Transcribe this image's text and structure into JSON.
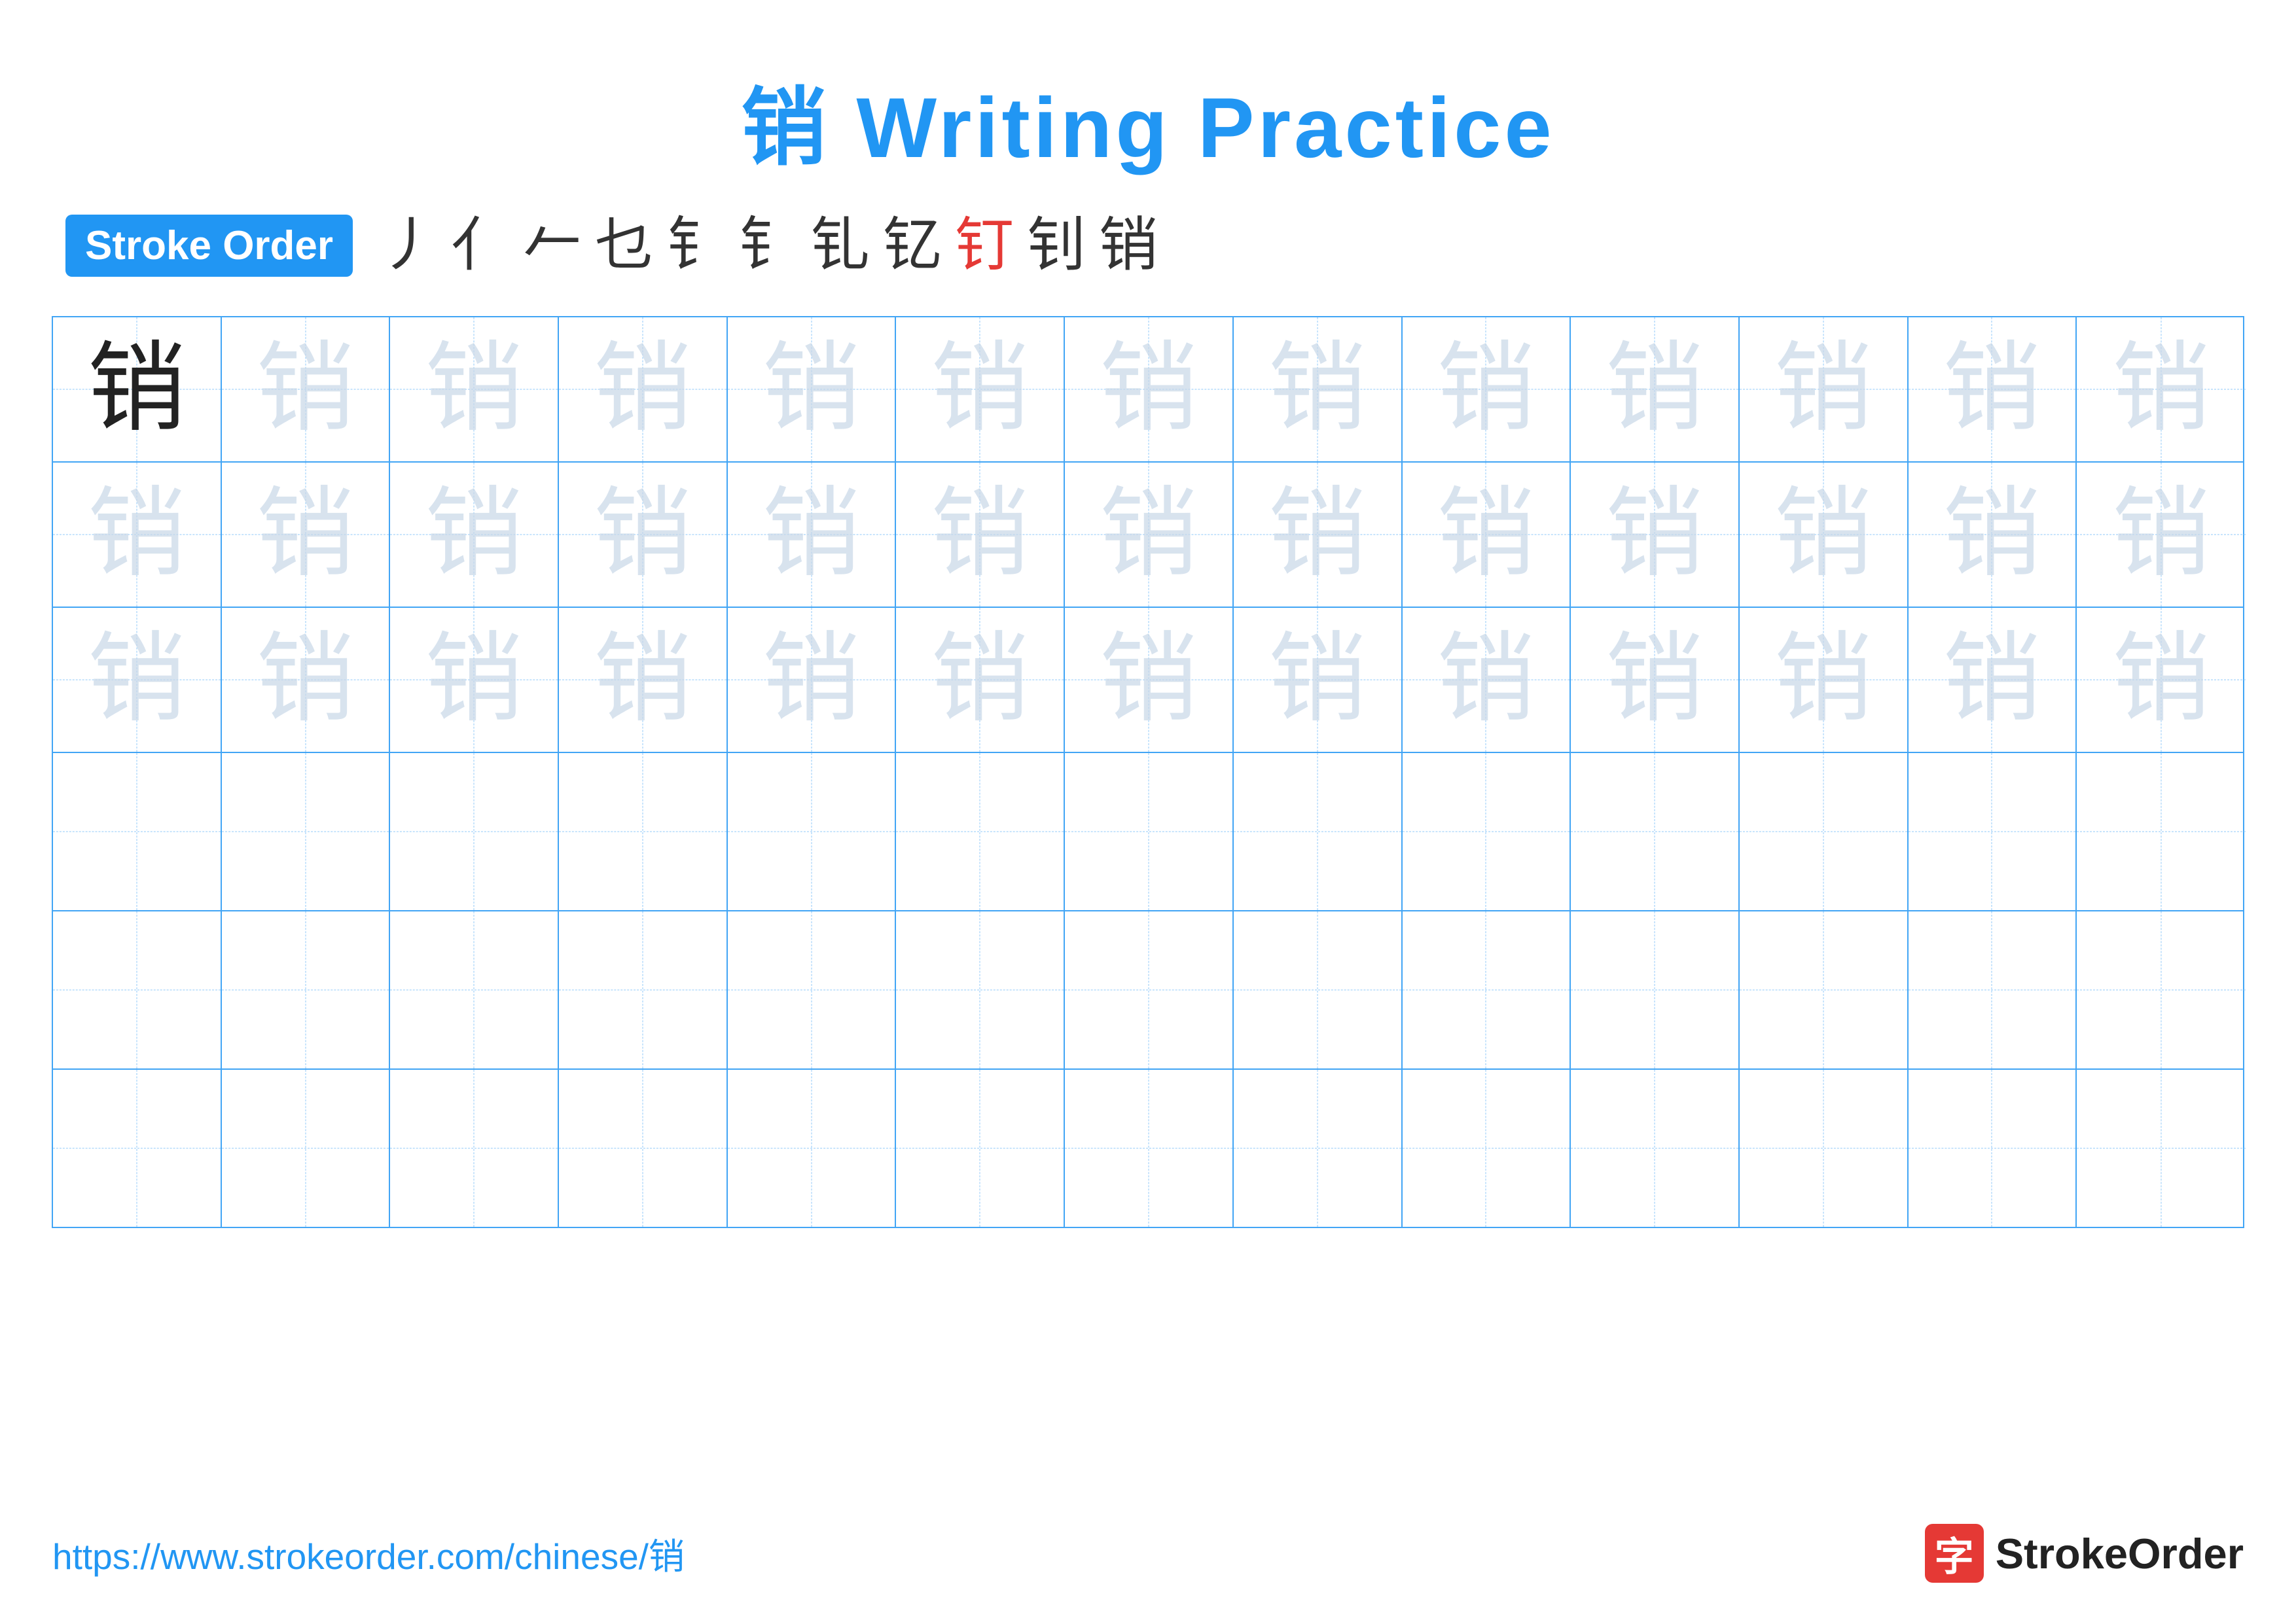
{
  "title": {
    "char": "销",
    "label": "Writing Practice",
    "full": "销 Writing Practice"
  },
  "stroke_order": {
    "badge_label": "Stroke Order",
    "strokes": [
      "丿",
      "亻",
      "𠂉",
      "乜",
      "钅",
      "钅",
      "钆",
      "钇",
      "钉",
      "钊",
      "销"
    ],
    "colors": [
      "black",
      "black",
      "black",
      "black",
      "black",
      "black",
      "black",
      "black",
      "red",
      "black",
      "black"
    ]
  },
  "grid": {
    "rows": 6,
    "cols": 13,
    "char": "销",
    "filled_rows": [
      {
        "type": "first",
        "cells": [
          {
            "opacity": "dark"
          },
          {
            "opacity": "light"
          },
          {
            "opacity": "light"
          },
          {
            "opacity": "light"
          },
          {
            "opacity": "light"
          },
          {
            "opacity": "light"
          },
          {
            "opacity": "light"
          },
          {
            "opacity": "light"
          },
          {
            "opacity": "light"
          },
          {
            "opacity": "light"
          },
          {
            "opacity": "light"
          },
          {
            "opacity": "light"
          },
          {
            "opacity": "light"
          }
        ]
      },
      {
        "type": "light",
        "cells": [
          {
            "opacity": "light"
          },
          {
            "opacity": "light"
          },
          {
            "opacity": "light"
          },
          {
            "opacity": "light"
          },
          {
            "opacity": "light"
          },
          {
            "opacity": "light"
          },
          {
            "opacity": "light"
          },
          {
            "opacity": "light"
          },
          {
            "opacity": "light"
          },
          {
            "opacity": "light"
          },
          {
            "opacity": "light"
          },
          {
            "opacity": "light"
          },
          {
            "opacity": "light"
          }
        ]
      },
      {
        "type": "light",
        "cells": [
          {
            "opacity": "light"
          },
          {
            "opacity": "light"
          },
          {
            "opacity": "light"
          },
          {
            "opacity": "light"
          },
          {
            "opacity": "light"
          },
          {
            "opacity": "light"
          },
          {
            "opacity": "light"
          },
          {
            "opacity": "light"
          },
          {
            "opacity": "light"
          },
          {
            "opacity": "light"
          },
          {
            "opacity": "light"
          },
          {
            "opacity": "light"
          },
          {
            "opacity": "light"
          }
        ]
      },
      {
        "type": "empty"
      },
      {
        "type": "empty"
      },
      {
        "type": "empty"
      }
    ]
  },
  "footer": {
    "url": "https://www.strokeorder.com/chinese/销",
    "logo_char": "字",
    "logo_label": "StrokeOrder"
  }
}
